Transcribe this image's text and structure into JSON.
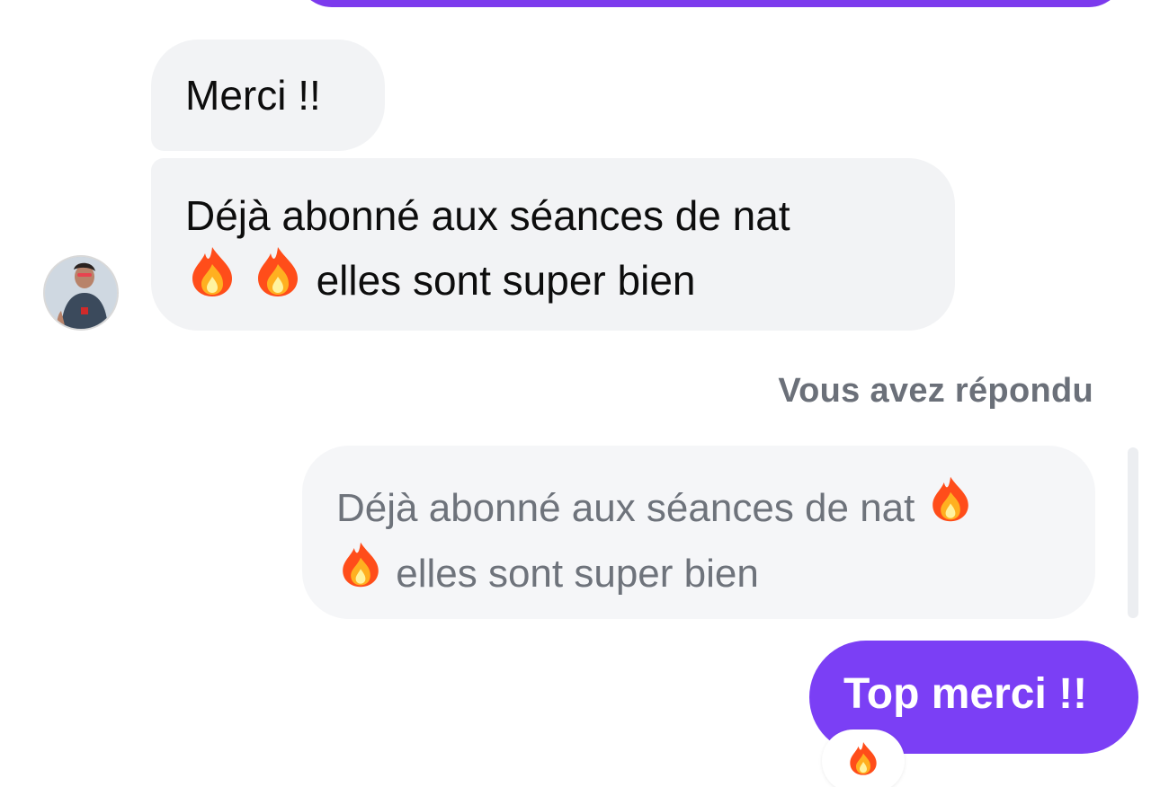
{
  "messages": {
    "incoming_1": {
      "text": "Merci !!"
    },
    "incoming_2": {
      "line1": "Déjà abonné aux séances de nat",
      "line2_suffix": "elles sont super bien"
    },
    "reply_label": "Vous avez répondu",
    "quoted": {
      "line1": "Déjà abonné aux séances de nat",
      "line2_suffix": "elles sont super bien"
    },
    "outgoing_1": {
      "text": "Top merci !!"
    }
  },
  "reactions": [
    "fire-emoji"
  ],
  "colors": {
    "outgoing_bubble": "#7b3ff5",
    "incoming_bubble": "#f2f3f5",
    "muted_text": "#6b7079"
  }
}
